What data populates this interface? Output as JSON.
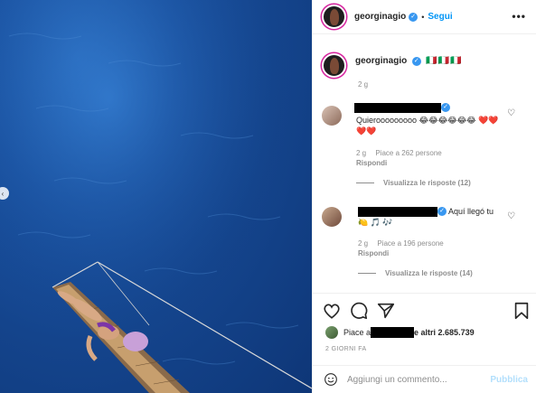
{
  "post": {
    "username": "georginagio",
    "follow_label": "Segui",
    "separator": "•",
    "more_label": "•••"
  },
  "caption": {
    "username": "georginagio",
    "text": "🇮🇹🇮🇹🇮🇹",
    "time": "2 g"
  },
  "comments": [
    {
      "text": "Quierooooooooo 😂😂😂😂😂😂 ❤️❤️❤️❤️",
      "time": "2 g",
      "likes": "Piace a 262 persone",
      "reply_label": "Rispondi",
      "view_replies": "Visualizza le risposte (12)"
    },
    {
      "text": "Aquí llegó tu 🍋 🎵 🎶",
      "time": "2 g",
      "likes": "Piace a 196 persone",
      "reply_label": "Rispondi",
      "view_replies": "Visualizza le risposte (14)"
    }
  ],
  "likes_summary": {
    "prefix": "Piace a",
    "suffix": "e altri 2.685.739"
  },
  "date": "2 GIORNI FA",
  "add_comment": {
    "placeholder": "Aggiungi un commento...",
    "publish_label": "Pubblica"
  },
  "icons": {
    "like": "heart-icon",
    "comment": "comment-icon",
    "share": "share-icon",
    "save": "bookmark-icon",
    "emoji": "smile-icon"
  },
  "colors": {
    "accent": "#0095f6",
    "verified": "#3897f0",
    "sea": "#1b55a6"
  }
}
